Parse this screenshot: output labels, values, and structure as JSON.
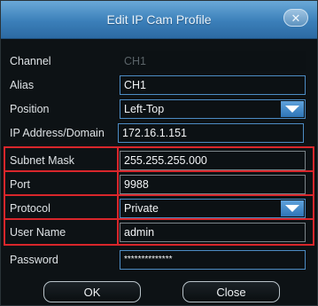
{
  "dialog": {
    "title": "Edit IP Cam Profile",
    "close_glyph": "✕"
  },
  "form": {
    "channel": {
      "label": "Channel",
      "value": "CH1"
    },
    "alias": {
      "label": "Alias",
      "value": "CH1"
    },
    "position": {
      "label": "Position",
      "value": "Left-Top"
    },
    "ip_address": {
      "label": "IP Address/Domain",
      "value": "172.16.1.151"
    },
    "subnet_mask": {
      "label": "Subnet Mask",
      "value": "255.255.255.000"
    },
    "port": {
      "label": "Port",
      "value": "9988"
    },
    "protocol": {
      "label": "Protocol",
      "value": "Private"
    },
    "user_name": {
      "label": "User Name",
      "value": "admin"
    },
    "password": {
      "label": "Password",
      "value": "**************"
    }
  },
  "buttons": {
    "ok": "OK",
    "close": "Close"
  },
  "colors": {
    "title_bar": "#3b7fb9",
    "highlight": "#d9262b",
    "field_border": "#4d8cc4",
    "background": "#0d1215"
  }
}
